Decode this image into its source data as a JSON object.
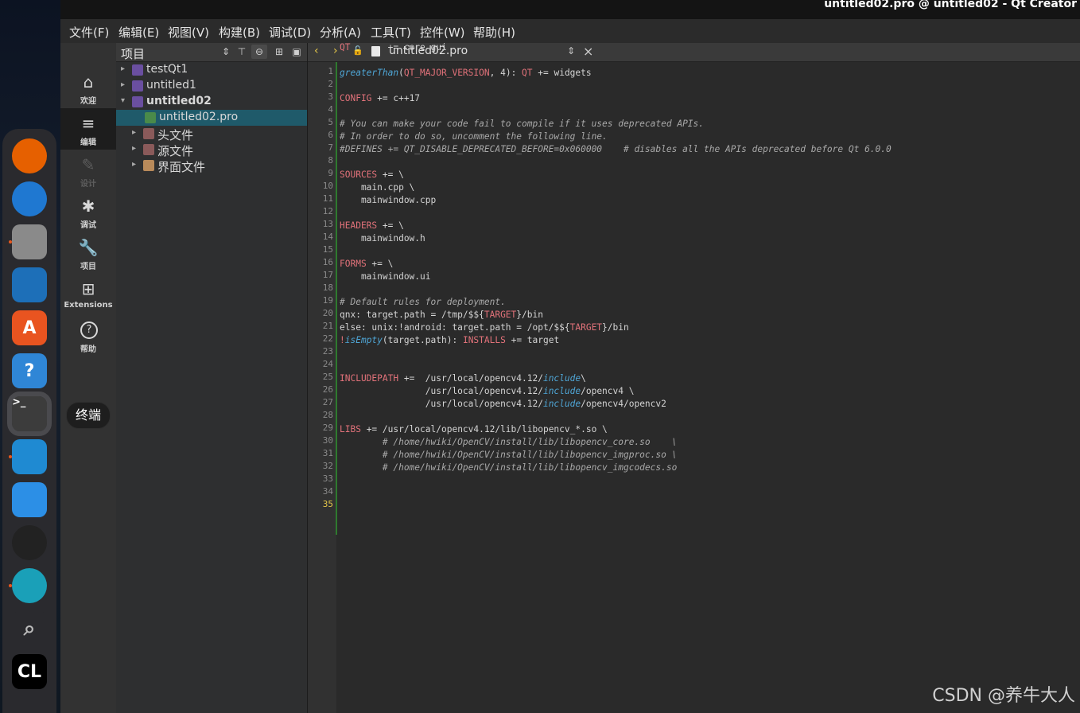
{
  "window": {
    "title": "untitled02.pro @ untitled02 - Qt Creator"
  },
  "menubar": [
    "文件(F)",
    "编辑(E)",
    "视图(V)",
    "构建(B)",
    "调试(D)",
    "分析(A)",
    "工具(T)",
    "控件(W)",
    "帮助(H)"
  ],
  "modes": [
    {
      "label": "欢迎",
      "icon": "home-icon"
    },
    {
      "label": "编辑",
      "icon": "edit-icon"
    },
    {
      "label": "设计",
      "icon": "design-icon"
    },
    {
      "label": "调试",
      "icon": "debug-icon"
    },
    {
      "label": "项目",
      "icon": "wrench-icon"
    },
    {
      "label": "Extensions",
      "icon": "extensions-icon"
    },
    {
      "label": "帮助",
      "icon": "help-icon"
    }
  ],
  "tooltip": "终端",
  "project_panel": {
    "title": "项目",
    "tree": [
      {
        "label": "testQt1",
        "bold": false,
        "expanded": false
      },
      {
        "label": "untitled1",
        "bold": false,
        "expanded": false
      },
      {
        "label": "untitled02",
        "bold": true,
        "expanded": true
      },
      {
        "label": "untitled02.pro",
        "bold": false,
        "selected": true
      },
      {
        "label": "头文件",
        "bold": false,
        "expanded": false
      },
      {
        "label": "源文件",
        "bold": false,
        "expanded": false
      },
      {
        "label": "界面文件",
        "bold": false,
        "expanded": false
      }
    ]
  },
  "editor": {
    "filename": "untitled02.pro",
    "current_line": 35,
    "lines": [
      "QT       += core gui",
      "",
      "greaterThan(QT_MAJOR_VERSION, 4): QT += widgets",
      "",
      "CONFIG += c++17",
      "",
      "# You can make your code fail to compile if it uses deprecated APIs.",
      "# In order to do so, uncomment the following line.",
      "#DEFINES += QT_DISABLE_DEPRECATED_BEFORE=0x060000    # disables all the APIs deprecated before Qt 6.0.0",
      "",
      "SOURCES += \\",
      "    main.cpp \\",
      "    mainwindow.cpp",
      "",
      "HEADERS += \\",
      "    mainwindow.h",
      "",
      "FORMS += \\",
      "    mainwindow.ui",
      "",
      "# Default rules for deployment.",
      "qnx: target.path = /tmp/$${TARGET}/bin",
      "else: unix:!android: target.path = /opt/$${TARGET}/bin",
      "!isEmpty(target.path): INSTALLS += target",
      "",
      "",
      "INCLUDEPATH +=  /usr/local/opencv4.12/include\\",
      "                /usr/local/opencv4.12/include/opencv4 \\",
      "                /usr/local/opencv4.12/include/opencv4/opencv2",
      "",
      "LIBS += /usr/local/opencv4.12/lib/libopencv_*.so \\",
      "        # /home/hwiki/OpenCV/install/lib/libopencv_core.so    \\",
      "        # /home/hwiki/OpenCV/install/lib/libopencv_imgproc.so \\",
      "        # /home/hwiki/OpenCV/install/lib/libopencv_imgcodecs.so",
      ""
    ]
  },
  "dock": [
    {
      "name": "firefox-icon",
      "color": "#e66000",
      "glyph": "",
      "running": false
    },
    {
      "name": "thunderbird-icon",
      "color": "#1f78d1",
      "glyph": "",
      "running": false
    },
    {
      "name": "files-icon",
      "color": "#8a8a8a",
      "glyph": "",
      "running": true
    },
    {
      "name": "writer-icon",
      "color": "#1d6fb8",
      "glyph": "",
      "running": false
    },
    {
      "name": "app-center-icon",
      "color": "#e95420",
      "glyph": "A",
      "running": false
    },
    {
      "name": "help-icon",
      "color": "#2f86d6",
      "glyph": "?",
      "running": false
    },
    {
      "name": "terminal-icon",
      "color": "#3c3c3c",
      "glyph": ">_",
      "running": false
    },
    {
      "name": "vscode-icon",
      "color": "#1f8ad2",
      "glyph": "",
      "running": true
    },
    {
      "name": "puzzle-icon",
      "color": "#2c8fe6",
      "glyph": "",
      "running": false
    },
    {
      "name": "obs-icon",
      "color": "#222222",
      "glyph": "",
      "running": false
    },
    {
      "name": "edge-icon",
      "color": "#1aa0b8",
      "glyph": "",
      "running": true
    },
    {
      "name": "search-icon",
      "color": "#2a2a2e",
      "glyph": "",
      "running": false
    },
    {
      "name": "clion-icon",
      "color": "#000000",
      "glyph": "CL",
      "running": false
    }
  ],
  "watermark": "CSDN @养牛大人",
  "colors": {
    "keyword": "#e2727a",
    "function": "#4fa6d6",
    "comment": "#a9a9a9",
    "selection": "#1f5a6a",
    "current_line": "#e6c84a"
  }
}
